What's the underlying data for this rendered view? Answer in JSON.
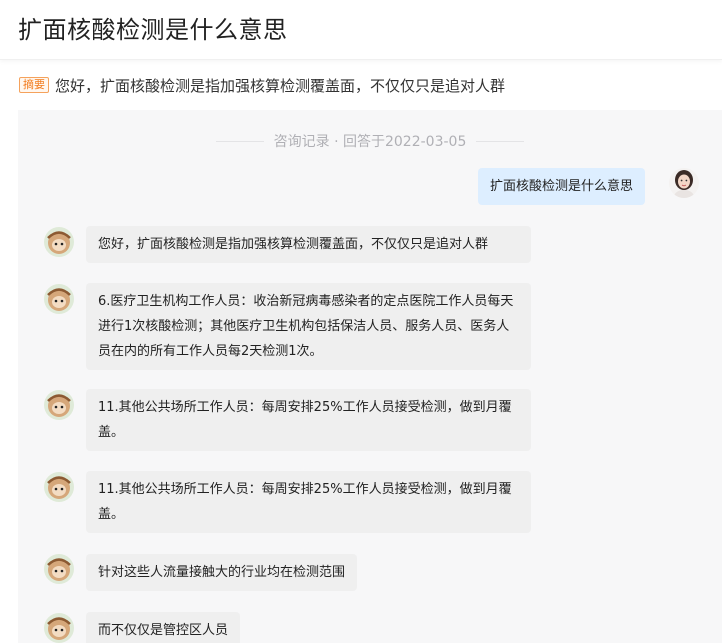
{
  "page": {
    "title": "扩面核酸检测是什么意思"
  },
  "summary": {
    "tag": "摘要",
    "text": "您好，扩面核酸检测是指加强核算检测覆盖面，不仅仅只是追对人群"
  },
  "consultation": {
    "record_label": "咨询记录 · 回答于2022-03-05",
    "question": "扩面核酸检测是什么意思",
    "answers": [
      "您好，扩面核酸检测是指加强核算检测覆盖面，不仅仅只是追对人群",
      "6.医疗卫生机构工作人员：收治新冠病毒感染者的定点医院工作人员每天进行1次核酸检测；其他医疗卫生机构包括保洁人员、服务人员、医务人员在内的所有工作人员每2天检测1次。",
      "11.其他公共场所工作人员：每周安排25%工作人员接受检测，做到月覆盖。",
      "11.其他公共场所工作人员：每周安排25%工作人员接受检测，做到月覆盖。",
      "针对这些人流量接触大的行业均在检测范围",
      "而不仅仅是管控区人员"
    ]
  },
  "icons": {
    "user_avatar": "woman-avatar-icon",
    "expert_avatar": "cartoon-avatar-icon"
  },
  "colors": {
    "accent_tag": "#f27c1f",
    "question_bubble": "#ddeeff",
    "answer_bubble": "#efefef",
    "panel_bg": "#f7f7f8"
  }
}
